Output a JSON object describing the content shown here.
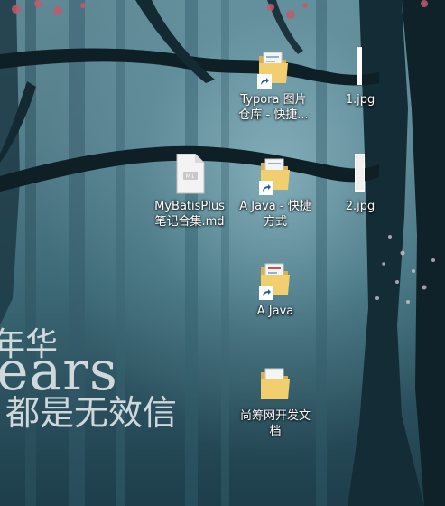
{
  "desktop": {
    "icons": [
      {
        "label_line1": "Typora 图片",
        "label_line2": "仓库 - 快捷...",
        "type": "folder-shortcut",
        "icon": "folder-icon"
      },
      {
        "label_line1": "1.jpg",
        "label_line2": "",
        "type": "image-file",
        "icon": "image-file-icon"
      },
      {
        "label_line1": "MyBatisPlus",
        "label_line2": "笔记合集.md",
        "type": "markdown-file",
        "icon": "markdown-file-icon"
      },
      {
        "label_line1": "A Java - 快捷",
        "label_line2": "方式",
        "type": "folder-shortcut",
        "icon": "folder-icon"
      },
      {
        "label_line1": "2.jpg",
        "label_line2": "",
        "type": "image-file",
        "icon": "image-file-icon"
      },
      {
        "label_line1": "A Java",
        "label_line2": "",
        "type": "folder-shortcut",
        "icon": "folder-icon"
      },
      {
        "label_line1": "尚筹网开发文",
        "label_line2": "档",
        "type": "folder",
        "icon": "folder-icon"
      }
    ]
  },
  "wallpaper": {
    "line1": "年华",
    "line2": "ears",
    "line3": "都是无效信"
  }
}
